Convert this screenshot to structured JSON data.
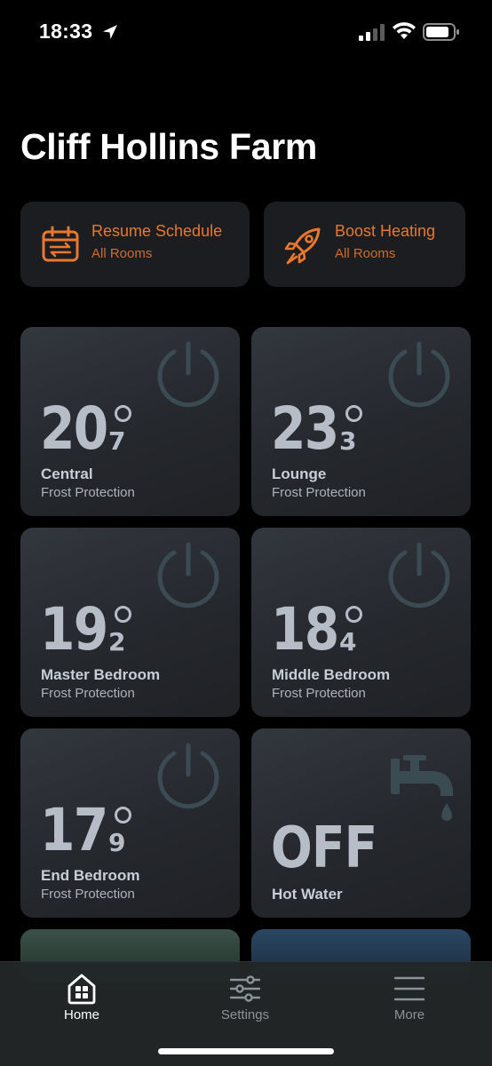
{
  "status_bar": {
    "time": "18:33",
    "icons": [
      "location-arrow-icon",
      "cellular-signal-icon",
      "wifi-icon",
      "battery-icon"
    ]
  },
  "page": {
    "title": "Cliff Hollins Farm"
  },
  "actions": [
    {
      "title": "Resume Schedule",
      "subtitle": "All Rooms",
      "icon": "calendar-icon"
    },
    {
      "title": "Boost Heating",
      "subtitle": "All Rooms",
      "icon": "rocket-icon"
    }
  ],
  "zones": [
    {
      "temp_whole": "20",
      "temp_decimal": "7",
      "name": "Central",
      "mode": "Frost Protection",
      "icon": "power-icon"
    },
    {
      "temp_whole": "23",
      "temp_decimal": "3",
      "name": "Lounge",
      "mode": "Frost Protection",
      "icon": "power-icon"
    },
    {
      "temp_whole": "19",
      "temp_decimal": "2",
      "name": "Master Bedroom",
      "mode": "Frost Protection",
      "icon": "power-icon"
    },
    {
      "temp_whole": "18",
      "temp_decimal": "4",
      "name": "Middle Bedroom",
      "mode": "Frost Protection",
      "icon": "power-icon"
    },
    {
      "temp_whole": "17",
      "temp_decimal": "9",
      "name": "End Bedroom",
      "mode": "Frost Protection",
      "icon": "power-icon"
    }
  ],
  "hot_water": {
    "state": "OFF",
    "name": "Hot Water",
    "icon": "tap-icon"
  },
  "tabs": [
    {
      "label": "Home",
      "icon": "home-icon",
      "active": true
    },
    {
      "label": "Settings",
      "icon": "sliders-icon",
      "active": false
    },
    {
      "label": "More",
      "icon": "menu-icon",
      "active": false
    }
  ],
  "colors": {
    "accent": "#e9782e",
    "tile_text": "#b7bdc6",
    "background": "#000000"
  }
}
